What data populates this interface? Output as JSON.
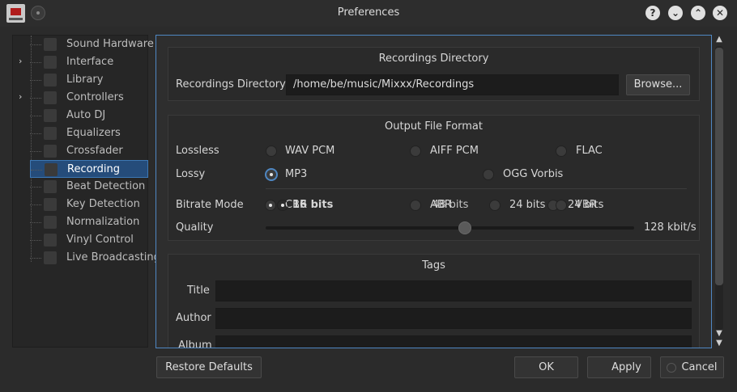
{
  "window": {
    "title": "Preferences"
  },
  "titlebar_buttons": {
    "help": "?",
    "minimize": "⌄",
    "maximize": "⌃",
    "close": "✕"
  },
  "sidebar": {
    "items": [
      {
        "label": "Sound Hardware",
        "icon": "speaker-icon"
      },
      {
        "label": "Interface",
        "icon": "interface-icon",
        "expandable": true
      },
      {
        "label": "Library",
        "icon": "library-icon"
      },
      {
        "label": "Controllers",
        "icon": "controller-icon",
        "expandable": true
      },
      {
        "label": "Auto DJ",
        "icon": "autodj-icon"
      },
      {
        "label": "Equalizers",
        "icon": "equalizer-icon"
      },
      {
        "label": "Crossfader",
        "icon": "crossfader-icon"
      },
      {
        "label": "Recording",
        "icon": "recording-icon",
        "selected": true
      },
      {
        "label": "Beat Detection",
        "icon": "beat-icon"
      },
      {
        "label": "Key Detection",
        "icon": "key-icon"
      },
      {
        "label": "Normalization",
        "icon": "normalization-icon"
      },
      {
        "label": "Vinyl Control",
        "icon": "vinyl-icon"
      },
      {
        "label": "Live Broadcasting",
        "icon": "broadcast-icon"
      }
    ],
    "expander_glyph": "›"
  },
  "recordings_directory": {
    "group_title": "Recordings Directory",
    "label": "Recordings Directory:",
    "path": "/home/be/music/Mixxx/Recordings",
    "browse_button": "Browse..."
  },
  "output_format": {
    "group_title": "Output File Format",
    "lossless_label": "Lossless",
    "lossless_options": [
      "WAV PCM",
      "AIFF PCM",
      "FLAC"
    ],
    "lossy_label": "Lossy",
    "lossy_options": [
      "MP3",
      "OGG Vorbis"
    ],
    "bitrate_mode_label": "Bitrate Mode",
    "bitrate_overlap_text": [
      "CBR",
      "16 bits",
      "ABR",
      "48 bits",
      "24 bits",
      "24 bits",
      "VBR"
    ],
    "quality_label": "Quality",
    "quality_value": "128 kbit/s",
    "quality_fraction": 0.54
  },
  "tags": {
    "group_title": "Tags",
    "title_label": "Title",
    "author_label": "Author",
    "album_label": "Album"
  },
  "footer": {
    "restore_defaults": "Restore Defaults",
    "ok": "OK",
    "apply": "Apply",
    "cancel": "Cancel"
  }
}
